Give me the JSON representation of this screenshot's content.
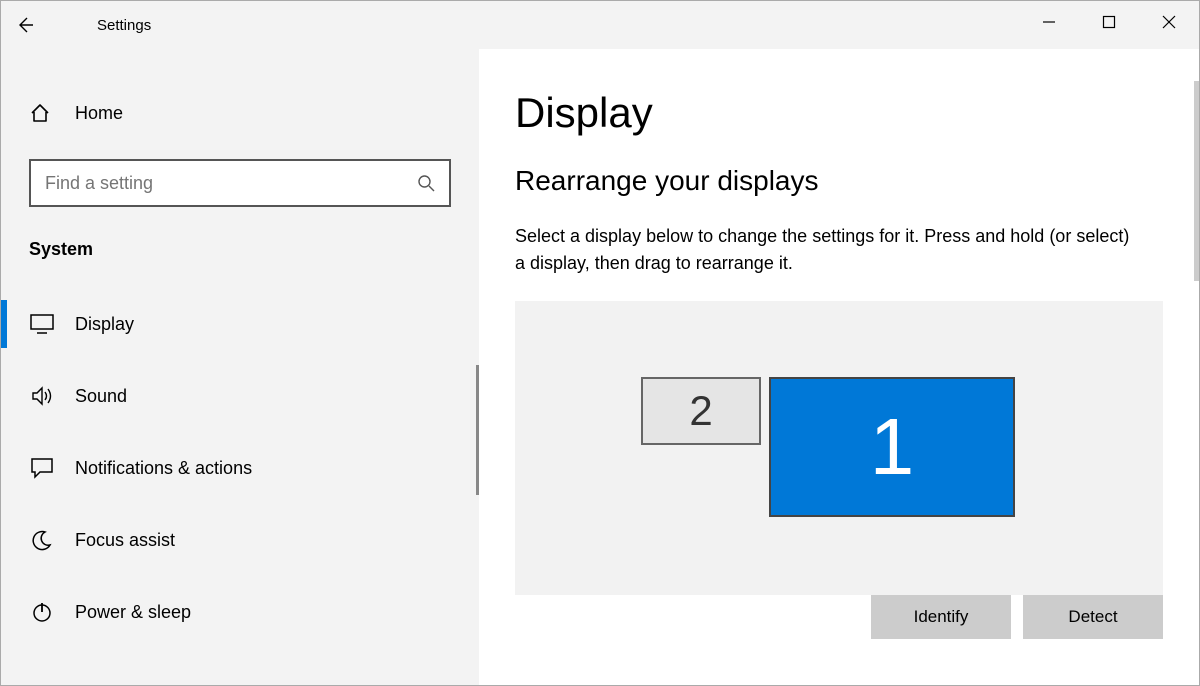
{
  "window": {
    "title": "Settings"
  },
  "sidebar": {
    "home_label": "Home",
    "search_placeholder": "Find a setting",
    "category": "System",
    "items": [
      {
        "label": "Display",
        "selected": true
      },
      {
        "label": "Sound"
      },
      {
        "label": "Notifications & actions"
      },
      {
        "label": "Focus assist"
      },
      {
        "label": "Power & sleep"
      }
    ]
  },
  "main": {
    "title": "Display",
    "section_title": "Rearrange your displays",
    "description": "Select a display below to change the settings for it. Press and hold (or select) a display, then drag to rearrange it.",
    "monitors": {
      "primary_label": "1",
      "secondary_label": "2"
    },
    "identify_label": "Identify",
    "detect_label": "Detect"
  }
}
